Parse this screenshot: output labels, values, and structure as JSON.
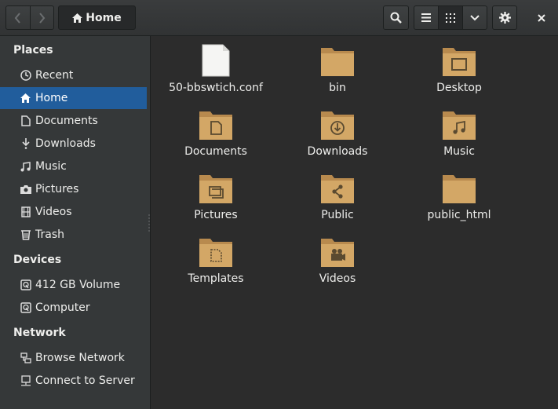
{
  "header": {
    "path_label": "Home",
    "icons": {
      "back": "go-back-icon",
      "forward": "go-forward-icon",
      "home": "home-icon",
      "search": "search-icon",
      "list_view": "list-view-icon",
      "grid_view": "grid-view-icon",
      "view_menu": "chevron-down-icon",
      "settings": "gear-icon",
      "close": "close-icon"
    }
  },
  "sidebar": {
    "places_title": "Places",
    "places": [
      {
        "label": "Recent",
        "icon": "clock-icon"
      },
      {
        "label": "Home",
        "icon": "home-icon",
        "selected": true
      },
      {
        "label": "Documents",
        "icon": "document-icon"
      },
      {
        "label": "Downloads",
        "icon": "download-icon"
      },
      {
        "label": "Music",
        "icon": "music-icon"
      },
      {
        "label": "Pictures",
        "icon": "camera-icon"
      },
      {
        "label": "Videos",
        "icon": "film-icon"
      },
      {
        "label": "Trash",
        "icon": "trash-icon"
      }
    ],
    "devices_title": "Devices",
    "devices": [
      {
        "label": "412 GB Volume",
        "icon": "drive-icon"
      },
      {
        "label": "Computer",
        "icon": "drive-icon"
      }
    ],
    "network_title": "Network",
    "network": [
      {
        "label": "Browse Network",
        "icon": "network-icon"
      },
      {
        "label": "Connect to Server",
        "icon": "server-icon"
      }
    ]
  },
  "files": [
    {
      "name": "50-bbswtich.conf",
      "kind": "text-file-icon"
    },
    {
      "name": "bin",
      "kind": "folder-icon"
    },
    {
      "name": "Desktop",
      "kind": "folder-desktop-icon"
    },
    {
      "name": "Documents",
      "kind": "folder-documents-icon"
    },
    {
      "name": "Downloads",
      "kind": "folder-download-icon"
    },
    {
      "name": "Music",
      "kind": "folder-music-icon"
    },
    {
      "name": "Pictures",
      "kind": "folder-pictures-icon"
    },
    {
      "name": "Public",
      "kind": "folder-publicshare-icon"
    },
    {
      "name": "public_html",
      "kind": "folder-icon"
    },
    {
      "name": "Templates",
      "kind": "folder-templates-icon"
    },
    {
      "name": "Videos",
      "kind": "folder-videos-icon"
    }
  ],
  "colors": {
    "folder": "#d3a766",
    "folder_dark": "#b88a4e",
    "folder_emblem": "#5a4a30",
    "selection": "#215d9c"
  }
}
